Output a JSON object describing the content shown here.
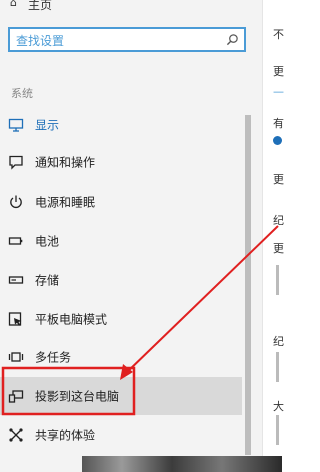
{
  "top_cut_text": "主页",
  "search": {
    "placeholder": "查找设置"
  },
  "section_label": "系统",
  "nav": [
    {
      "label": "显示",
      "icon": "monitor-icon"
    },
    {
      "label": "通知和操作",
      "icon": "chat-bubble-icon"
    },
    {
      "label": "电源和睡眠",
      "icon": "power-icon"
    },
    {
      "label": "电池",
      "icon": "battery-icon"
    },
    {
      "label": "存储",
      "icon": "storage-icon"
    },
    {
      "label": "平板电脑模式",
      "icon": "tablet-icon"
    },
    {
      "label": "多任务",
      "icon": "multitask-icon"
    },
    {
      "label": "投影到这台电脑",
      "icon": "project-icon"
    },
    {
      "label": "共享的体验",
      "icon": "shared-experience-icon"
    }
  ],
  "right_fragments": [
    "不",
    "更",
    "—",
    "有",
    "更",
    "纪",
    "更",
    "纪",
    "大"
  ],
  "colors": {
    "accent": "#1e6fb8",
    "annotation": "#e02020",
    "search_border": "#4a9bd6"
  }
}
